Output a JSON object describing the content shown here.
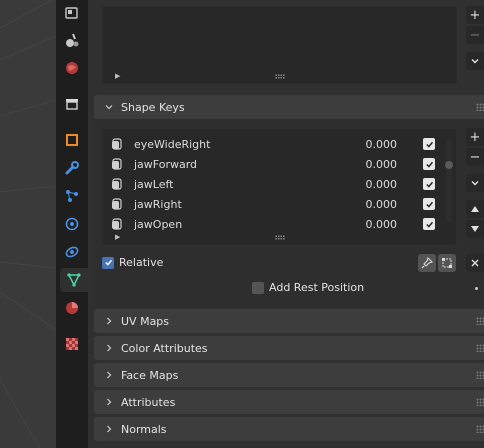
{
  "colors": {
    "accent_blue": "#4772b3",
    "object_data_icon": "#4cd6a6",
    "active_tab_bg": "#303030",
    "panel_header_bg": "#3d3d3d"
  },
  "sidebar_tabs": [
    {
      "name": "render-icon",
      "active": false
    },
    {
      "name": "texture-paint-icon",
      "active": false
    },
    {
      "name": "world-icon",
      "active": false
    },
    {
      "name": "collection-icon",
      "active": false
    },
    {
      "name": "object-icon",
      "active": false
    },
    {
      "name": "modifier-wrench-icon",
      "active": false
    },
    {
      "name": "particles-icon",
      "active": false
    },
    {
      "name": "physics-icon",
      "active": false
    },
    {
      "name": "constraints-icon",
      "active": false
    },
    {
      "name": "object-data-icon",
      "active": true
    },
    {
      "name": "material-icon",
      "active": false
    },
    {
      "name": "texture-icon",
      "active": false
    }
  ],
  "top_list": {
    "add_symbol": "+",
    "remove_symbol": "−"
  },
  "shape_keys": {
    "header": "Shape Keys",
    "items": [
      {
        "name": "eyeWideRight",
        "value": "0.000"
      },
      {
        "name": "jawForward",
        "value": "0.000"
      },
      {
        "name": "jawLeft",
        "value": "0.000"
      },
      {
        "name": "jawRight",
        "value": "0.000"
      },
      {
        "name": "jawOpen",
        "value": "0.000"
      }
    ],
    "add_symbol": "+",
    "remove_symbol": "−",
    "relative_label": "Relative",
    "relative_checked": true,
    "add_rest_position_label": "Add Rest Position",
    "add_rest_position_checked": false
  },
  "collapsed_panels": [
    {
      "label": "UV Maps"
    },
    {
      "label": "Color Attributes"
    },
    {
      "label": "Face Maps"
    },
    {
      "label": "Attributes"
    },
    {
      "label": "Normals"
    }
  ]
}
